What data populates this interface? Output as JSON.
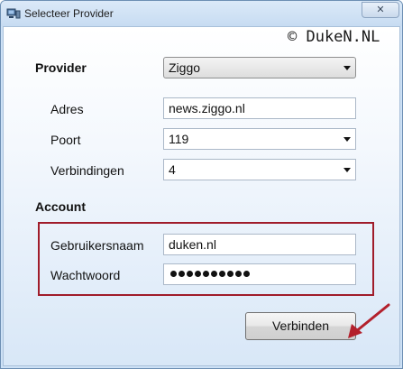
{
  "window": {
    "title": "Selecteer Provider",
    "close_glyph": "✕"
  },
  "watermark": "© DukeN.NL",
  "provider": {
    "label": "Provider",
    "value": "Ziggo"
  },
  "adres": {
    "label": "Adres",
    "value": "news.ziggo.nl"
  },
  "poort": {
    "label": "Poort",
    "value": "119"
  },
  "verbindingen": {
    "label": "Verbindingen",
    "value": "4"
  },
  "account": {
    "heading": "Account",
    "username_label": "Gebruikersnaam",
    "username_value": "duken.nl",
    "password_label": "Wachtwoord"
  },
  "buttons": {
    "connect_label": "Verbinden"
  },
  "colors": {
    "highlight": "#a01c2a",
    "arrow": "#b3202c"
  },
  "icons": {
    "app": "network-computer-icon",
    "close": "close-icon",
    "dropdown": "chevron-down-icon",
    "annotation": "annotation-arrow-icon"
  }
}
